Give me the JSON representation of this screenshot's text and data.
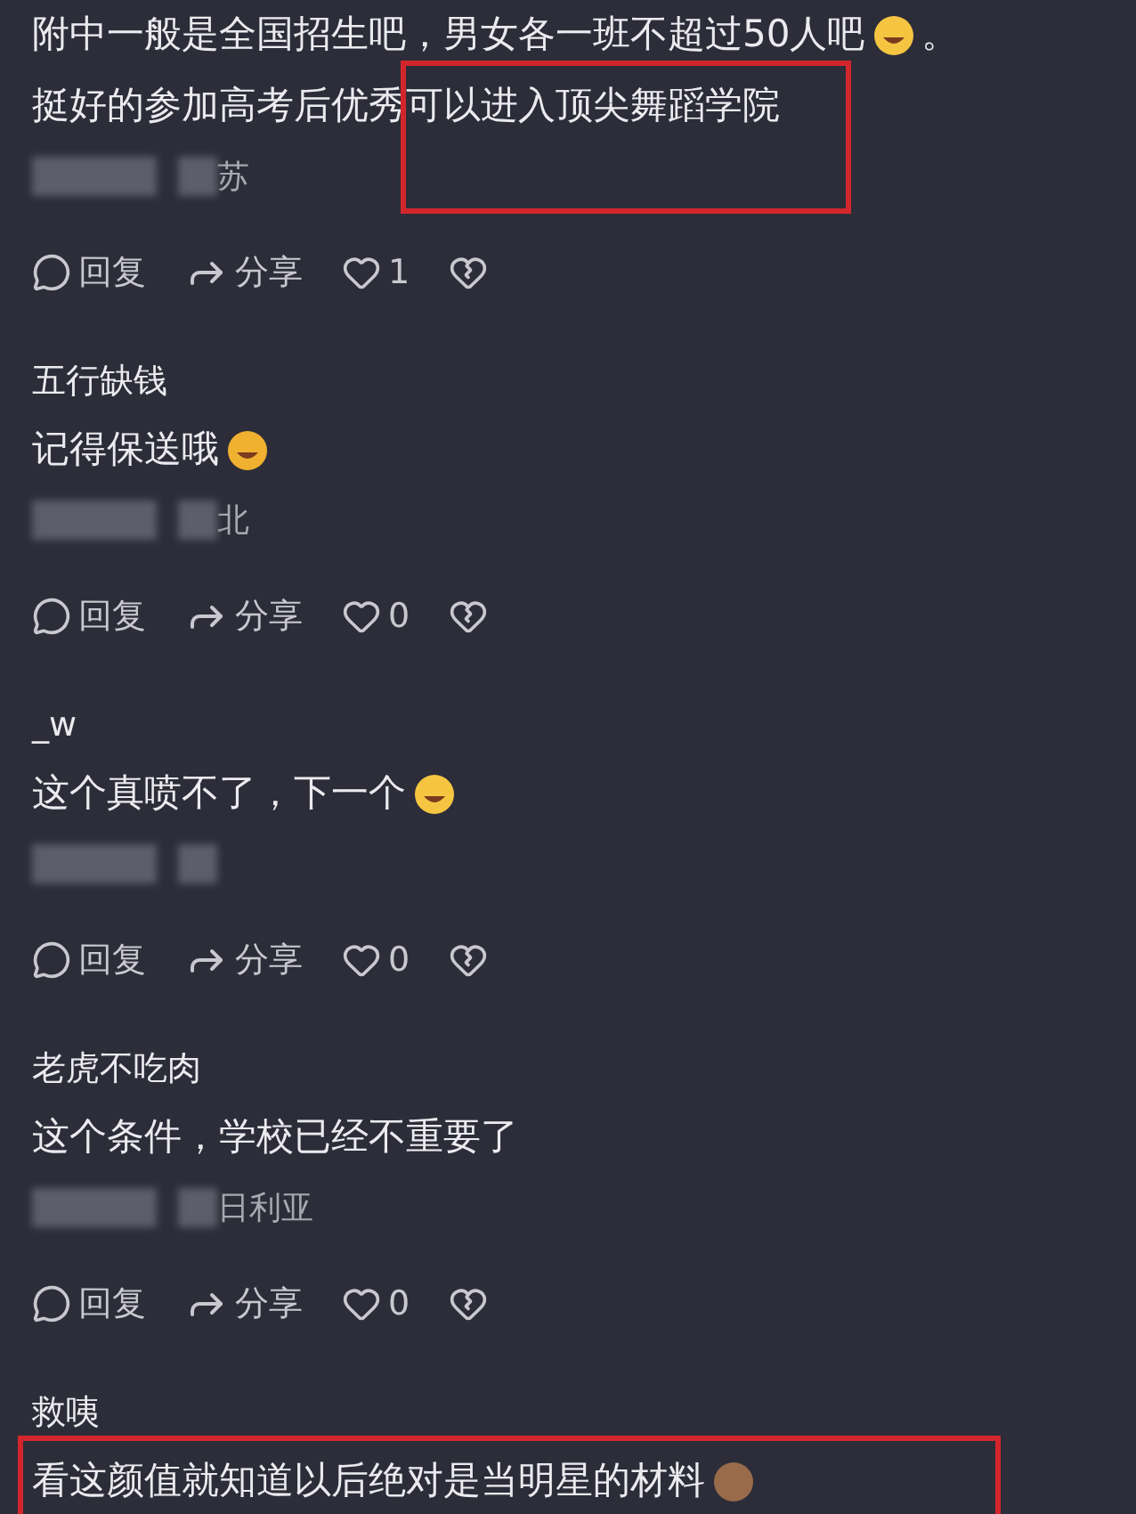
{
  "comments": [
    {
      "lines": [
        {
          "segments": [
            {
              "kind": "text",
              "text": "附中一般是全国招生吧，男女各一班不超过50人吧"
            },
            {
              "kind": "laugh"
            },
            {
              "kind": "text",
              "text": "。"
            }
          ]
        },
        {
          "segments": [
            {
              "kind": "text",
              "text": "挺好的参加高考后优秀"
            },
            {
              "kind": "text",
              "text": "可以进入顶尖舞蹈学院",
              "highlighted": true
            }
          ]
        }
      ],
      "location": "苏",
      "reply": "回复",
      "share": "分享",
      "likes": "1"
    },
    {
      "username": "五行缺钱",
      "lines": [
        {
          "segments": [
            {
              "kind": "text",
              "text": "记得保送哦"
            },
            {
              "kind": "starstruck"
            }
          ]
        }
      ],
      "location": "北",
      "reply": "回复",
      "share": "分享",
      "likes": "0"
    },
    {
      "username": "_w",
      "lines": [
        {
          "segments": [
            {
              "kind": "text",
              "text": "这个真喷不了，下一个"
            },
            {
              "kind": "laugh"
            }
          ]
        }
      ],
      "reply": "回复",
      "share": "分享",
      "likes": "0"
    },
    {
      "username": "老虎不吃肉",
      "lines": [
        {
          "segments": [
            {
              "kind": "text",
              "text": "这个条件，学校已经不重要了"
            }
          ]
        }
      ],
      "location": "日利亚",
      "reply": "回复",
      "share": "分享",
      "likes": "0"
    },
    {
      "username": "救咦",
      "lines": [
        {
          "highlighted": true,
          "segments": [
            {
              "kind": "text",
              "text": "看这颜值就知道以后绝对是当明星的材料"
            },
            {
              "kind": "monkey"
            }
          ]
        }
      ]
    }
  ]
}
